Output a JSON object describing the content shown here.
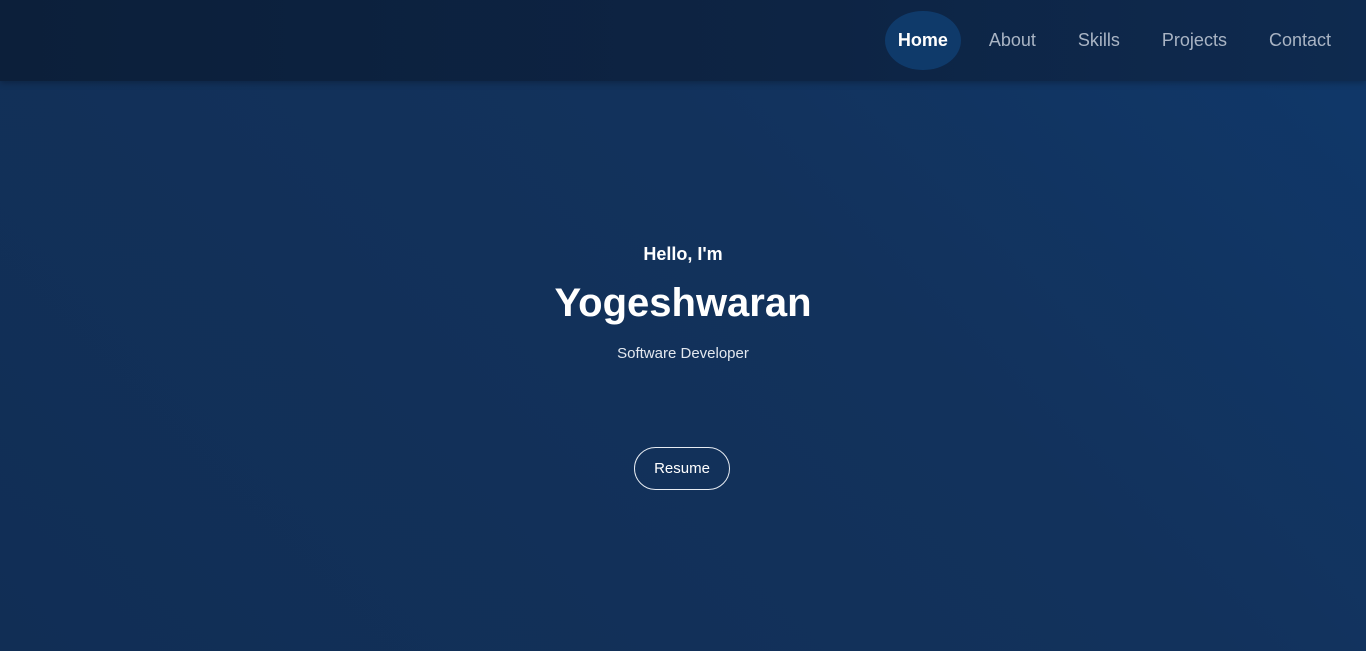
{
  "nav": {
    "items": [
      {
        "label": "Home"
      },
      {
        "label": "About"
      },
      {
        "label": "Skills"
      },
      {
        "label": "Projects"
      },
      {
        "label": "Contact"
      }
    ],
    "active": "Home"
  },
  "hero": {
    "greeting": "Hello, I'm",
    "name": "Yogeshwaran",
    "role": "Software Developer",
    "resume_label": "Resume"
  },
  "colors": {
    "nav_bg": "#0c1f3a",
    "page_bg": "#12325c",
    "active_pill": "#0f3a6a",
    "text": "#ffffff",
    "nav_text": "#a9b4c4"
  }
}
